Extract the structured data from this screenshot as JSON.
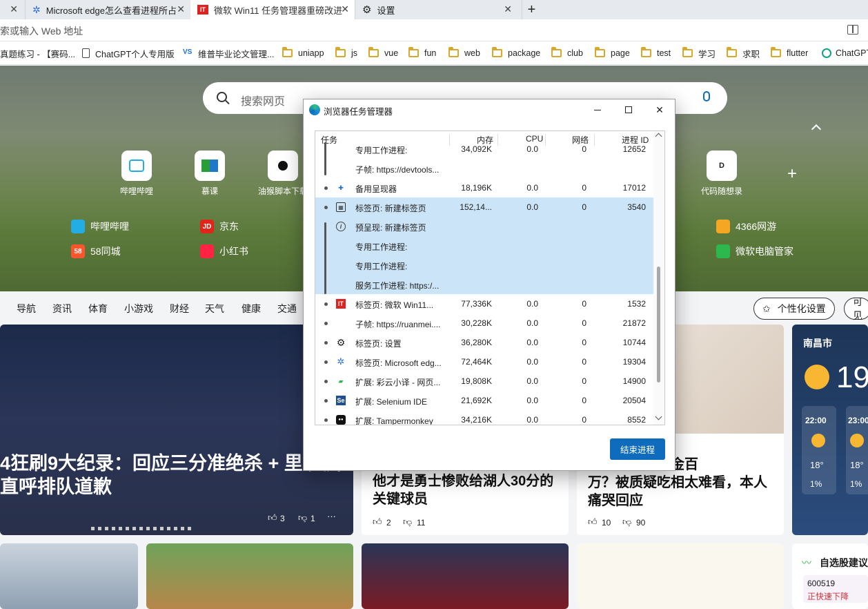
{
  "browser": {
    "tabs": [
      {
        "title": "Microsoft edge怎么查看进程所占",
        "icon": "paw-icon",
        "active": false
      },
      {
        "title": "微软 Win11 任务管理器重磅改进",
        "icon": "ithome-icon",
        "active": true
      },
      {
        "title": "设置",
        "icon": "gear-icon",
        "active": false
      }
    ],
    "new_tab_symbol": "+",
    "close_symbol": "✕",
    "address_placeholder": "索或输入 Web 地址",
    "bookmarks": [
      {
        "label": "真题练习 - 【赛码...",
        "type": "page"
      },
      {
        "label": "ChatGPT个人专用版",
        "type": "doc"
      },
      {
        "label": "维普毕业论文管理...",
        "type": "site"
      },
      {
        "label": "uniapp",
        "type": "folder"
      },
      {
        "label": "js",
        "type": "folder"
      },
      {
        "label": "vue",
        "type": "folder"
      },
      {
        "label": "fun",
        "type": "folder"
      },
      {
        "label": "web",
        "type": "folder"
      },
      {
        "label": "package",
        "type": "folder"
      },
      {
        "label": "club",
        "type": "folder"
      },
      {
        "label": "page",
        "type": "folder"
      },
      {
        "label": "test",
        "type": "folder"
      },
      {
        "label": "学习",
        "type": "folder"
      },
      {
        "label": "求职",
        "type": "folder"
      },
      {
        "label": "flutter",
        "type": "folder"
      },
      {
        "label": "ChatGPT",
        "type": "site"
      }
    ]
  },
  "newtab": {
    "search_placeholder": "搜索网页",
    "quicklinks": [
      {
        "label": "哔哩哔哩"
      },
      {
        "label": "慕课"
      },
      {
        "label": "油猴脚本下载"
      },
      {
        "label": "代码随想录"
      }
    ],
    "sites_left": [
      {
        "label": "哔哩哔哩",
        "color": "#23ade5",
        "glyph": "b"
      },
      {
        "label": "京东",
        "color": "#e1251b",
        "glyph": "JD"
      },
      {
        "label": "58同城",
        "color": "#ff552e",
        "glyph": "58"
      },
      {
        "label": "小红书",
        "color": "#ff2442",
        "glyph": "书"
      }
    ],
    "sites_right": [
      {
        "label": "4366网游",
        "color": "#f5a623",
        "glyph": "猫"
      },
      {
        "label": "微软电脑管家",
        "color": "#2db84d",
        "glyph": "田"
      }
    ],
    "nav": [
      "导航",
      "资讯",
      "体育",
      "小游戏",
      "财经",
      "天气",
      "健康",
      "交通"
    ],
    "personalize_label": "个性化设置",
    "partial_pill": "可见",
    "card1_headline": "4狂刷9大纪录：回应三分准绝杀 + 里 美媒直呼排队道歉",
    "card1_likes": "3",
    "card1_dislikes": "1",
    "card2_headline": "他才是勇士惨败给湖人30分的关键球员",
    "card2_likes": "2",
    "card2_dislikes": "11",
    "card3_headline": "万？被质疑吃相太难看，本人痛哭回应",
    "card3_headline_top": "播带货直播捞金百",
    "card3_likes": "10",
    "card3_dislikes": "90",
    "weather_city": "南昌市",
    "weather_temp": "19",
    "weather_hours": [
      {
        "time": "22:00",
        "temp": "18°",
        "rain": "1%"
      },
      {
        "time": "23:00",
        "temp": "18°",
        "rain": "1%"
      }
    ],
    "stock_title": "自选股建议",
    "stock_code": "600519",
    "stock_status": "正快速下降"
  },
  "taskmanager": {
    "title": "浏览器任务管理器",
    "columns": {
      "task": "任务",
      "memory": "内存",
      "cpu": "CPU",
      "network": "网络",
      "pid": "进程 ID"
    },
    "rows": [
      {
        "name": "专用工作进程:",
        "memory": "34,092K",
        "cpu": "0.0",
        "network": "0",
        "pid": "12652",
        "icon": "",
        "selected": false,
        "partial": true
      },
      {
        "name": "子帧: https://devtools...",
        "memory": "",
        "cpu": "",
        "network": "",
        "pid": "",
        "icon": "",
        "selected": false
      },
      {
        "name": "备用呈现器",
        "memory": "18,196K",
        "cpu": "0.0",
        "network": "0",
        "pid": "17012",
        "icon": "puzzle-icon",
        "selected": false
      },
      {
        "name": "标签页: 新建标签页",
        "memory": "152,14...",
        "cpu": "0.0",
        "network": "0",
        "pid": "3540",
        "icon": "newtab-icon",
        "selected": true
      },
      {
        "name": "预呈现: 新建标签页",
        "memory": "",
        "cpu": "",
        "network": "",
        "pid": "",
        "icon": "info-icon",
        "selected": true
      },
      {
        "name": "专用工作进程:",
        "memory": "",
        "cpu": "",
        "network": "",
        "pid": "",
        "icon": "",
        "selected": true
      },
      {
        "name": "专用工作进程:",
        "memory": "",
        "cpu": "",
        "network": "",
        "pid": "",
        "icon": "",
        "selected": true
      },
      {
        "name": "服务工作进程: https:/...",
        "memory": "",
        "cpu": "",
        "network": "",
        "pid": "",
        "icon": "",
        "selected": true
      },
      {
        "name": "标签页: 微软 Win11...",
        "memory": "77,336K",
        "cpu": "0.0",
        "network": "0",
        "pid": "1532",
        "icon": "ithome-icon",
        "selected": false
      },
      {
        "name": "子帧: https://ruanmei....",
        "memory": "30,228K",
        "cpu": "0.0",
        "network": "0",
        "pid": "21872",
        "icon": "",
        "selected": false
      },
      {
        "name": "标签页: 设置",
        "memory": "36,280K",
        "cpu": "0.0",
        "network": "0",
        "pid": "10744",
        "icon": "gear-icon",
        "selected": false
      },
      {
        "name": "标签页: Microsoft edg...",
        "memory": "72,464K",
        "cpu": "0.0",
        "network": "0",
        "pid": "19304",
        "icon": "paw-icon",
        "selected": false
      },
      {
        "name": "扩展: 彩云小译 - 网页...",
        "memory": "19,808K",
        "cpu": "0.0",
        "network": "0",
        "pid": "14900",
        "icon": "caiyun-icon",
        "selected": false
      },
      {
        "name": "扩展: Selenium IDE",
        "memory": "21,692K",
        "cpu": "0.0",
        "network": "0",
        "pid": "20504",
        "icon": "selenium-icon",
        "selected": false
      },
      {
        "name": "扩展: Tampermonkey",
        "memory": "34,216K",
        "cpu": "0.0",
        "network": "0",
        "pid": "8552",
        "icon": "tampermonkey-icon",
        "selected": false
      }
    ],
    "end_process_label": "结束进程",
    "selection_color": "#cce4f7",
    "accent": "#0f6cbd"
  }
}
